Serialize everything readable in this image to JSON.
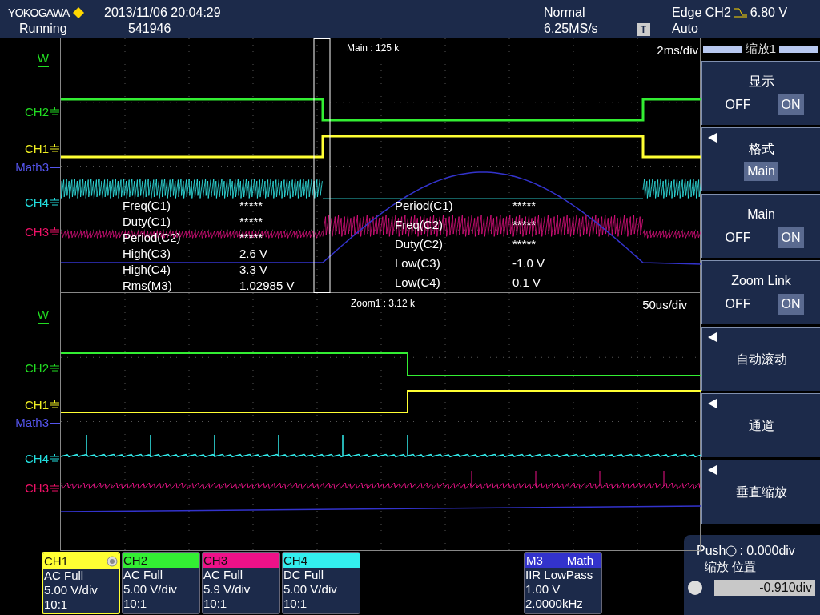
{
  "header": {
    "brand": "YOKOGAWA",
    "status": "Running",
    "datetime": "2013/11/06 20:04:29",
    "count": "541946",
    "mode": "Normal",
    "sample_rate": "6.25MS/s",
    "trigger_marker": "T",
    "trigger": "Edge CH2",
    "trigger_level": "6.80 V",
    "trigger_mode": "Auto"
  },
  "panels": [
    {
      "label": "Main : 125 k",
      "timebase": "2ms/div",
      "markers": [
        {
          "label": "W",
          "kind": "window",
          "color": "#22dd22"
        },
        {
          "label": "CH2",
          "kind": "channel",
          "color": "#22dd22"
        },
        {
          "label": "CH1",
          "kind": "channel",
          "color": "#eeee22"
        },
        {
          "label": "Math3",
          "kind": "math",
          "color": "#5555ee"
        },
        {
          "label": "CH4",
          "kind": "channel",
          "color": "#22dddd"
        },
        {
          "label": "CH3",
          "kind": "channel",
          "color": "#ee1166"
        }
      ],
      "measurements": [
        [
          {
            "name": "Freq(C1)",
            "value": "*****"
          },
          {
            "name": "Duty(C1)",
            "value": "*****"
          },
          {
            "name": "Period(C2)",
            "value": "*****"
          },
          {
            "name": "High(C3)",
            "value": "2.6 V"
          },
          {
            "name": "High(C4)",
            "value": "3.3 V"
          },
          {
            "name": "Rms(M3)",
            "value": "1.02985 V"
          }
        ],
        [
          {
            "name": "Period(C1)",
            "value": "*****"
          },
          {
            "name": "Freq(C2)",
            "value": "*****"
          },
          {
            "name": "Duty(C2)",
            "value": "*****"
          },
          {
            "name": "Low(C3)",
            "value": "-1.0 V"
          },
          {
            "name": "Low(C4)",
            "value": "0.1 V"
          }
        ]
      ]
    },
    {
      "label": "Zoom1 : 3.12 k",
      "timebase": "50us/div",
      "markers": [
        {
          "label": "W",
          "kind": "window",
          "color": "#22dd22"
        },
        {
          "label": "CH2",
          "kind": "channel",
          "color": "#22dd22"
        },
        {
          "label": "CH1",
          "kind": "channel",
          "color": "#eeee22"
        },
        {
          "label": "Math3",
          "kind": "math",
          "color": "#5555ee"
        },
        {
          "label": "CH4",
          "kind": "channel",
          "color": "#22dddd"
        },
        {
          "label": "CH3",
          "kind": "channel",
          "color": "#ee1166"
        }
      ]
    }
  ],
  "menu": {
    "title": "缩放1",
    "items": [
      {
        "kind": "toggle",
        "label": "显示",
        "arrow": false,
        "options": [
          {
            "label": "OFF",
            "selected": false
          },
          {
            "label": "ON",
            "selected": true
          }
        ]
      },
      {
        "kind": "select",
        "label": "格式",
        "arrow": true,
        "value": "Main"
      },
      {
        "kind": "toggle",
        "label": "Main",
        "arrow": false,
        "options": [
          {
            "label": "OFF",
            "selected": false
          },
          {
            "label": "ON",
            "selected": true
          }
        ]
      },
      {
        "kind": "toggle",
        "label": "Zoom Link",
        "arrow": false,
        "options": [
          {
            "label": "OFF",
            "selected": false
          },
          {
            "label": "ON",
            "selected": true
          }
        ]
      },
      {
        "kind": "submenu",
        "label": "自动滚动",
        "arrow": true
      },
      {
        "kind": "submenu",
        "label": "通道",
        "arrow": true
      },
      {
        "kind": "submenu",
        "label": "垂直缩放",
        "arrow": true
      }
    ]
  },
  "channels": [
    {
      "name": "CH1",
      "color": "#ffff33",
      "selected": true,
      "lines": [
        "AC Full",
        "5.00 V/div",
        "10:1"
      ]
    },
    {
      "name": "CH2",
      "color": "#33ee33",
      "selected": false,
      "lines": [
        "AC Full",
        "5.00 V/div",
        "10:1"
      ]
    },
    {
      "name": "CH3",
      "color": "#ee1188",
      "selected": false,
      "lines": [
        "AC Full",
        "5.9 V/div",
        "10:1"
      ]
    },
    {
      "name": "CH4",
      "color": "#33eeee",
      "selected": false,
      "lines": [
        "DC Full",
        "5.00 V/div",
        "10:1"
      ]
    }
  ],
  "math": {
    "name": "M3",
    "title": "Math",
    "color": "#3333cc",
    "lines": [
      "IIR LowPass",
      "1.00 V",
      "2.0000kHz"
    ]
  },
  "knob": {
    "push": "Push",
    "push_value": ": 0.000div",
    "labels": "缩放 位置",
    "value": "-0.910div"
  }
}
